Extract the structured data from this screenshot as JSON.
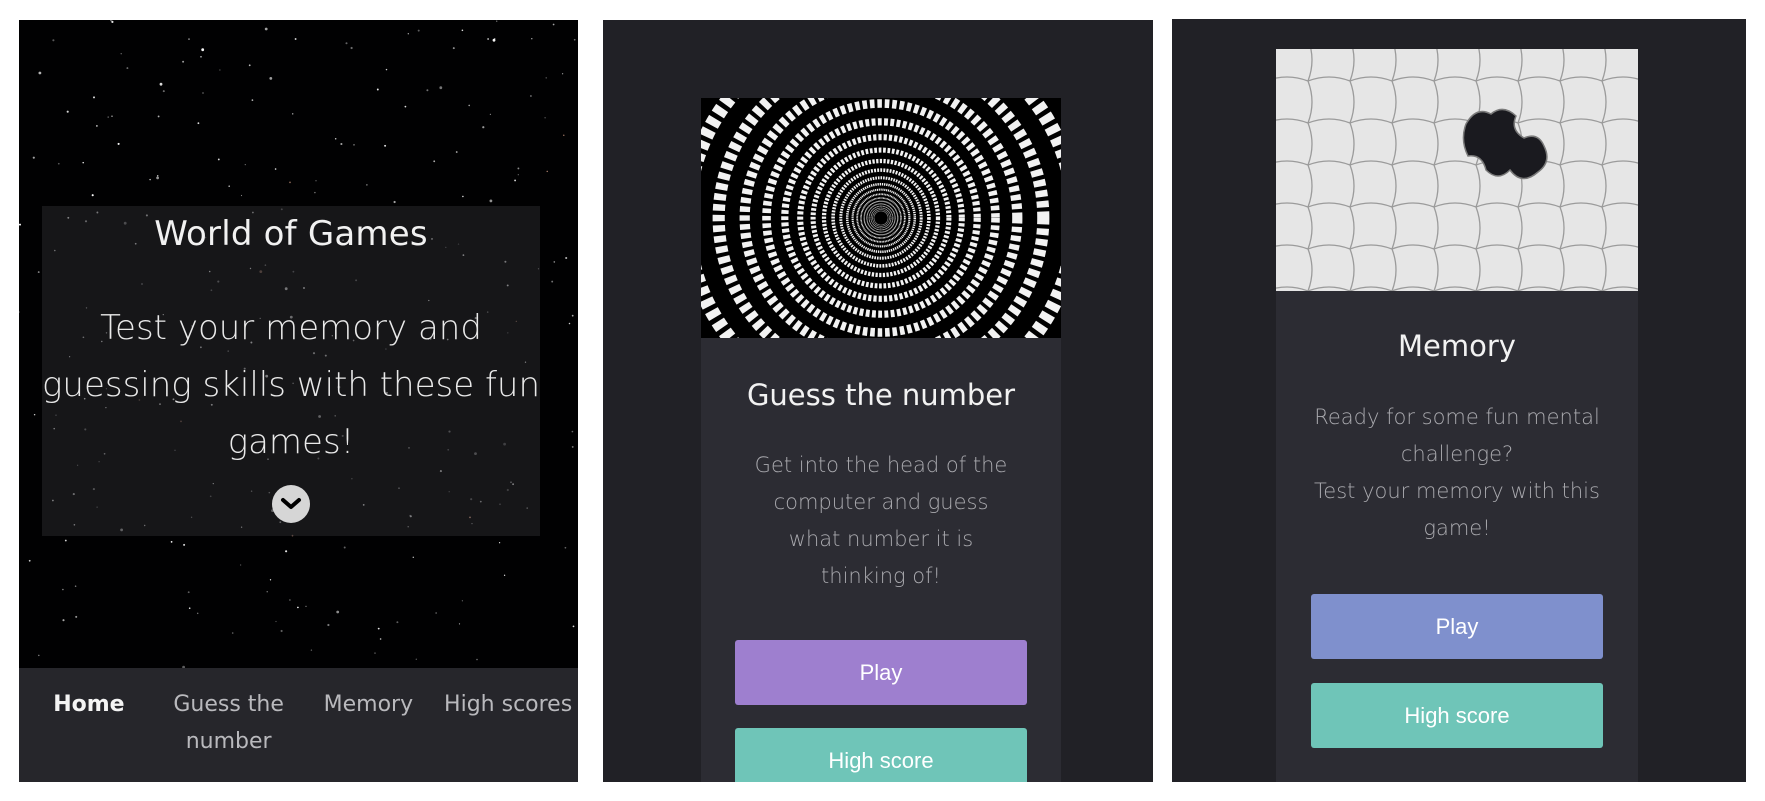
{
  "home": {
    "title": "World of Games",
    "tagline": "Test your memory and guessing skills with these fun games!",
    "scroll_icon": "chevron-down-circle-icon",
    "nav": [
      {
        "label": "Home",
        "active": true
      },
      {
        "label": "Guess the number",
        "active": false
      },
      {
        "label": "Memory",
        "active": false
      },
      {
        "label": "High scores",
        "active": false
      }
    ]
  },
  "guess_game": {
    "title": "Guess the number",
    "description": "Get into the head of the computer and guess what number it is thinking of!",
    "play_label": "Play",
    "highscore_label": "High score",
    "play_color": "#9e7fcf",
    "highscore_color": "#6fc5b8"
  },
  "memory_game": {
    "title": "Memory",
    "description_line1": "Ready for some fun mental challenge?",
    "description_line2": "Test your memory with this game!",
    "play_label": "Play",
    "highscore_label": "High score",
    "play_color": "#7f90cd",
    "highscore_color": "#6fc5b8"
  },
  "colors": {
    "background": "#212126",
    "card": "#2c2c33",
    "nav": "#26262b"
  }
}
